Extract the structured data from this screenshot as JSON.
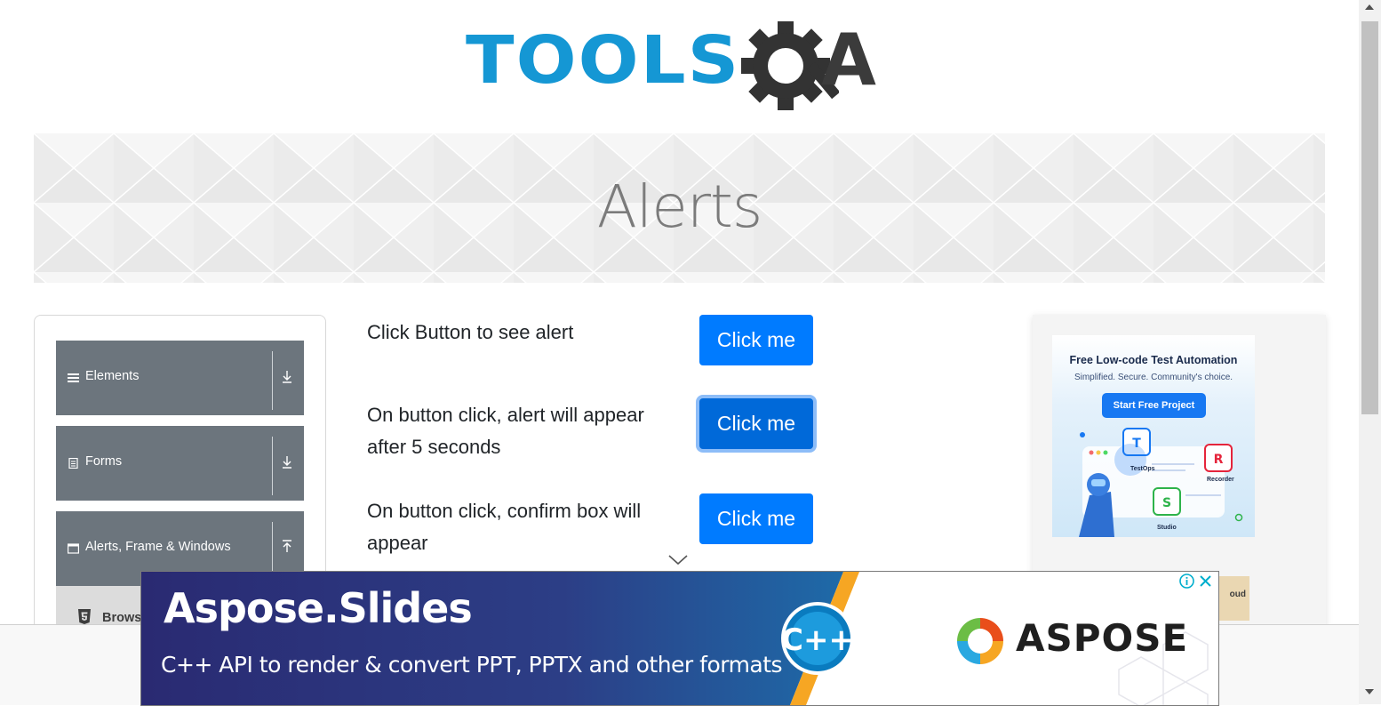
{
  "logo": {
    "part1": "TOOLS",
    "part2": "QA"
  },
  "banner": {
    "title": "Alerts"
  },
  "sidebar": {
    "groups": [
      {
        "label": "Elements",
        "icon": "menu-icon",
        "arrow": "download-arrow-icon"
      },
      {
        "label": "Forms",
        "icon": "form-icon",
        "arrow": "download-arrow-icon"
      },
      {
        "label": "Alerts, Frame & Windows",
        "icon": "window-icon",
        "arrow": "upload-arrow-icon"
      }
    ],
    "sub_item": {
      "label": "Brows",
      "icon": "html5-icon"
    }
  },
  "alerts": {
    "rows": [
      {
        "text": "Click Button to see alert",
        "button": "Click me"
      },
      {
        "text": "On button click, alert will appear after 5 seconds",
        "button": "Click me"
      },
      {
        "text": "On button click, confirm box will appear",
        "button": "Click me"
      }
    ]
  },
  "right_ad": {
    "headline": "Free Low-code Test Automation",
    "tagline": "Simplified. Secure. Community's choice.",
    "cta": "Start Free Project",
    "tools": [
      "TestOps",
      "Recorder",
      "Studio"
    ],
    "peek_text": "oud"
  },
  "bottom_ad": {
    "title": "Aspose.Slides",
    "subtitle": "C++ API to render & convert PPT, PPTX and other formats",
    "brand": "ASPOSE",
    "cpp_label": "C++"
  },
  "colors": {
    "primary_button": "#007bff",
    "logo_blue": "#1597d4",
    "sidebar_gray": "#6c757d"
  }
}
